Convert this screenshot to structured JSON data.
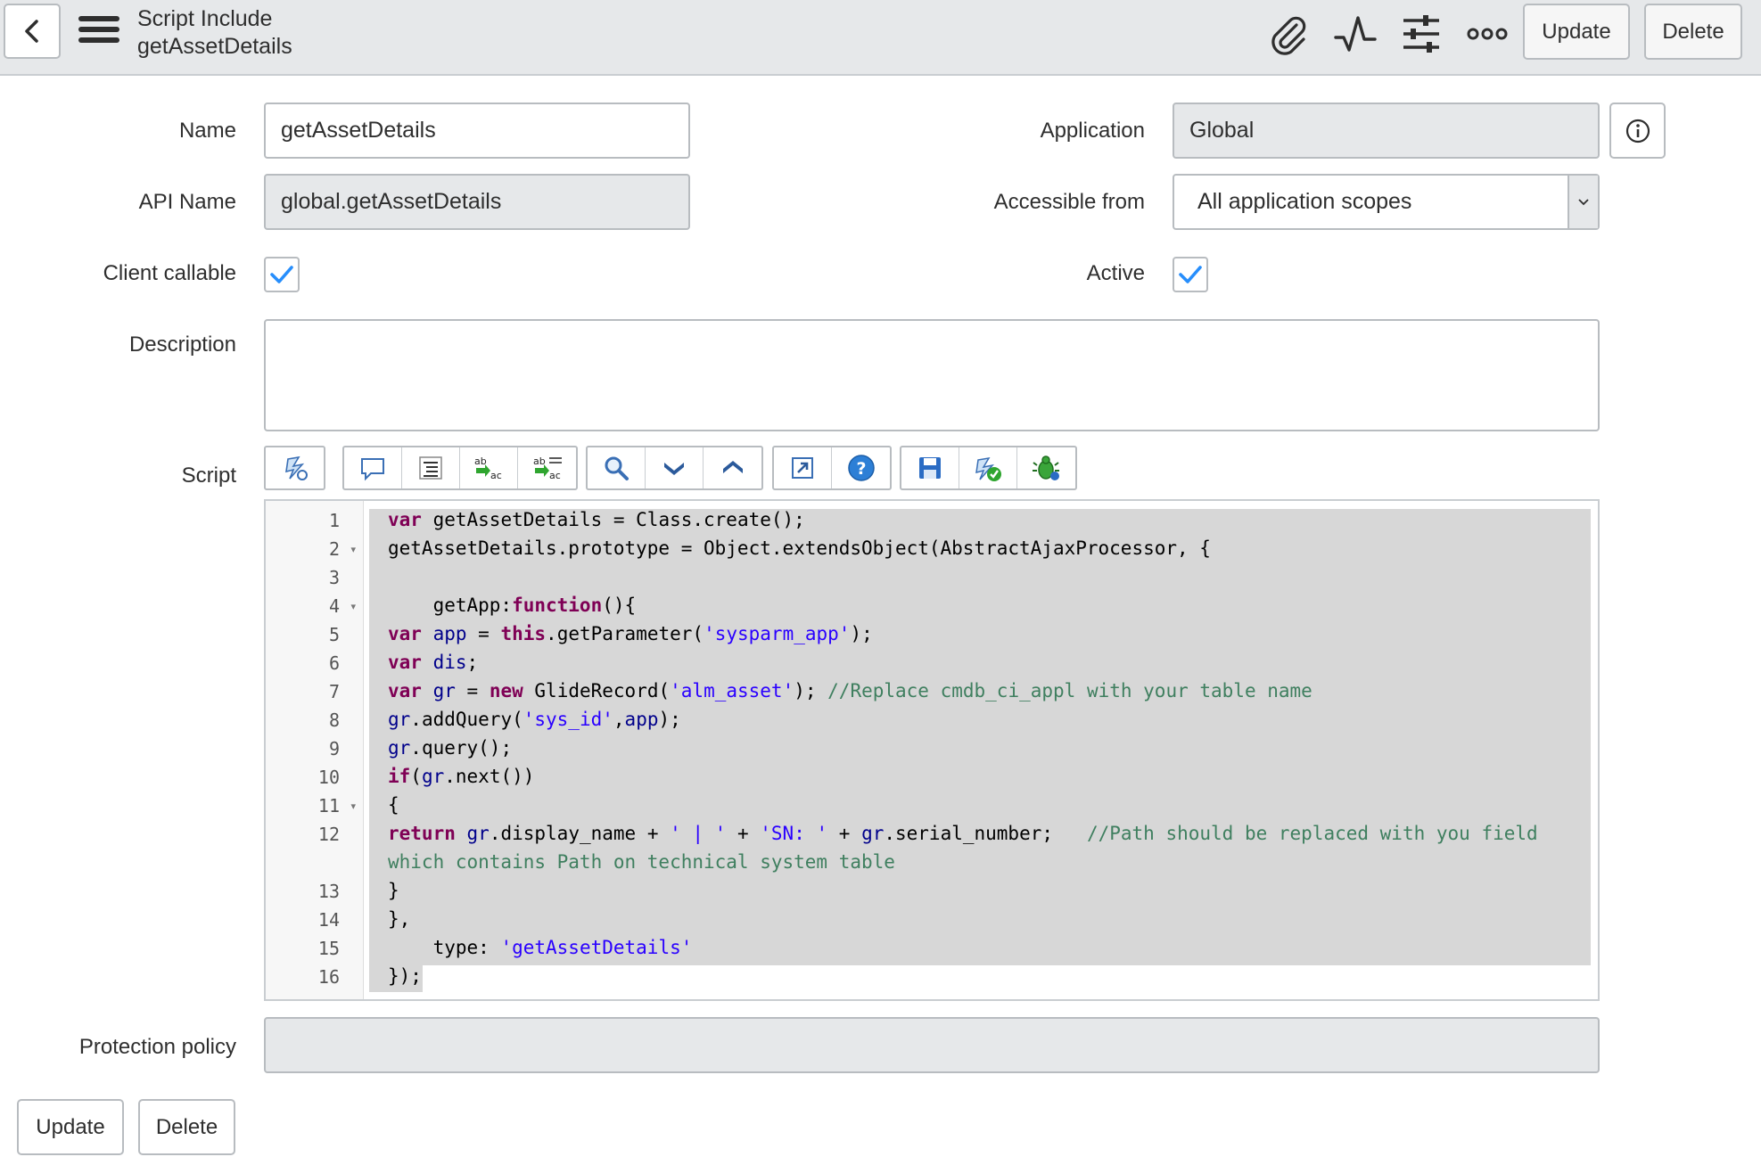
{
  "header": {
    "record_type": "Script Include",
    "record_name": "getAssetDetails",
    "update_label": "Update",
    "delete_label": "Delete",
    "icons": [
      "back-icon",
      "menu-icon",
      "paperclip-icon",
      "activity-icon",
      "settings-sliders-icon",
      "more-options-icon"
    ]
  },
  "form": {
    "name_label": "Name",
    "name_value": "getAssetDetails",
    "api_name_label": "API Name",
    "api_name_value": "global.getAssetDetails",
    "client_callable_label": "Client callable",
    "client_callable_checked": true,
    "description_label": "Description",
    "description_value": "",
    "script_label": "Script",
    "application_label": "Application",
    "application_value": "Global",
    "accessible_from_label": "Accessible from",
    "accessible_from_value": "All application scopes",
    "active_label": "Active",
    "active_checked": true,
    "protection_policy_label": "Protection policy",
    "protection_policy_value": ""
  },
  "script_toolbar": {
    "groups": [
      [
        "toggle-syntax-icon"
      ],
      [
        "comment-icon",
        "format-code-icon",
        "replace-icon",
        "replace-all-icon"
      ],
      [
        "search-icon",
        "find-next-icon",
        "find-previous-icon"
      ],
      [
        "fullscreen-icon",
        "help-icon"
      ],
      [
        "save-icon",
        "check-syntax-icon",
        "debug-icon"
      ]
    ]
  },
  "script": {
    "lines": [
      {
        "n": "1",
        "fold": false
      },
      {
        "n": "2",
        "fold": true
      },
      {
        "n": "3",
        "fold": false
      },
      {
        "n": "4",
        "fold": true
      },
      {
        "n": "5",
        "fold": false
      },
      {
        "n": "6",
        "fold": false
      },
      {
        "n": "7",
        "fold": false
      },
      {
        "n": "8",
        "fold": false
      },
      {
        "n": "9",
        "fold": false
      },
      {
        "n": "10",
        "fold": false
      },
      {
        "n": "11",
        "fold": true
      },
      {
        "n": "12",
        "fold": false
      },
      {
        "n": "",
        "fold": false
      },
      {
        "n": "13",
        "fold": false
      },
      {
        "n": "14",
        "fold": false
      },
      {
        "n": "15",
        "fold": false
      },
      {
        "n": "16",
        "fold": false
      }
    ],
    "code": [
      [
        {
          "t": "kw",
          "s": "var"
        },
        {
          "t": "",
          "s": " getAssetDetails = Class.create();"
        }
      ],
      [
        {
          "t": "",
          "s": "getAssetDetails.prototype = Object.extendsObject(AbstractAjaxProcessor, {"
        }
      ],
      [
        {
          "t": "",
          "s": ""
        }
      ],
      [
        {
          "t": "",
          "s": "    getApp:"
        },
        {
          "t": "kw",
          "s": "function"
        },
        {
          "t": "",
          "s": "(){"
        }
      ],
      [
        {
          "t": "kw",
          "s": "var"
        },
        {
          "t": "",
          "s": " "
        },
        {
          "t": "vr",
          "s": "app"
        },
        {
          "t": "",
          "s": " = "
        },
        {
          "t": "kw",
          "s": "this"
        },
        {
          "t": "",
          "s": ".getParameter("
        },
        {
          "t": "str",
          "s": "'sysparm_app'"
        },
        {
          "t": "",
          "s": ");"
        }
      ],
      [
        {
          "t": "kw",
          "s": "var"
        },
        {
          "t": "",
          "s": " "
        },
        {
          "t": "vr",
          "s": "dis"
        },
        {
          "t": "",
          "s": ";"
        }
      ],
      [
        {
          "t": "kw",
          "s": "var"
        },
        {
          "t": "",
          "s": " "
        },
        {
          "t": "vr",
          "s": "gr"
        },
        {
          "t": "",
          "s": " = "
        },
        {
          "t": "kw",
          "s": "new"
        },
        {
          "t": "",
          "s": " GlideRecord("
        },
        {
          "t": "str",
          "s": "'alm_asset'"
        },
        {
          "t": "",
          "s": "); "
        },
        {
          "t": "cmt",
          "s": "//Replace cmdb_ci_appl with your table name"
        }
      ],
      [
        {
          "t": "vr",
          "s": "gr"
        },
        {
          "t": "",
          "s": ".addQuery("
        },
        {
          "t": "str",
          "s": "'sys_id'"
        },
        {
          "t": "",
          "s": ","
        },
        {
          "t": "vr",
          "s": "app"
        },
        {
          "t": "",
          "s": ");"
        }
      ],
      [
        {
          "t": "vr",
          "s": "gr"
        },
        {
          "t": "",
          "s": ".query();"
        }
      ],
      [
        {
          "t": "kw",
          "s": "if"
        },
        {
          "t": "",
          "s": "("
        },
        {
          "t": "vr",
          "s": "gr"
        },
        {
          "t": "",
          "s": ".next())"
        }
      ],
      [
        {
          "t": "",
          "s": "{"
        }
      ],
      [
        {
          "t": "kw",
          "s": "return"
        },
        {
          "t": "",
          "s": " "
        },
        {
          "t": "vr",
          "s": "gr"
        },
        {
          "t": "",
          "s": ".display_name + "
        },
        {
          "t": "str",
          "s": "' | '"
        },
        {
          "t": "",
          "s": " + "
        },
        {
          "t": "str",
          "s": "'SN: '"
        },
        {
          "t": "",
          "s": " + "
        },
        {
          "t": "vr",
          "s": "gr"
        },
        {
          "t": "",
          "s": ".serial_number;   "
        },
        {
          "t": "cmt",
          "s": "//Path should be replaced with you field"
        }
      ],
      [
        {
          "t": "cmt",
          "s": "which contains Path on technical system table"
        }
      ],
      [
        {
          "t": "",
          "s": "}"
        }
      ],
      [
        {
          "t": "",
          "s": "},"
        }
      ],
      [
        {
          "t": "",
          "s": "    type: "
        },
        {
          "t": "str",
          "s": "'getAssetDetails'"
        }
      ],
      [
        {
          "t": "",
          "s": "});"
        }
      ]
    ]
  },
  "footer": {
    "update_label": "Update",
    "delete_label": "Delete"
  }
}
